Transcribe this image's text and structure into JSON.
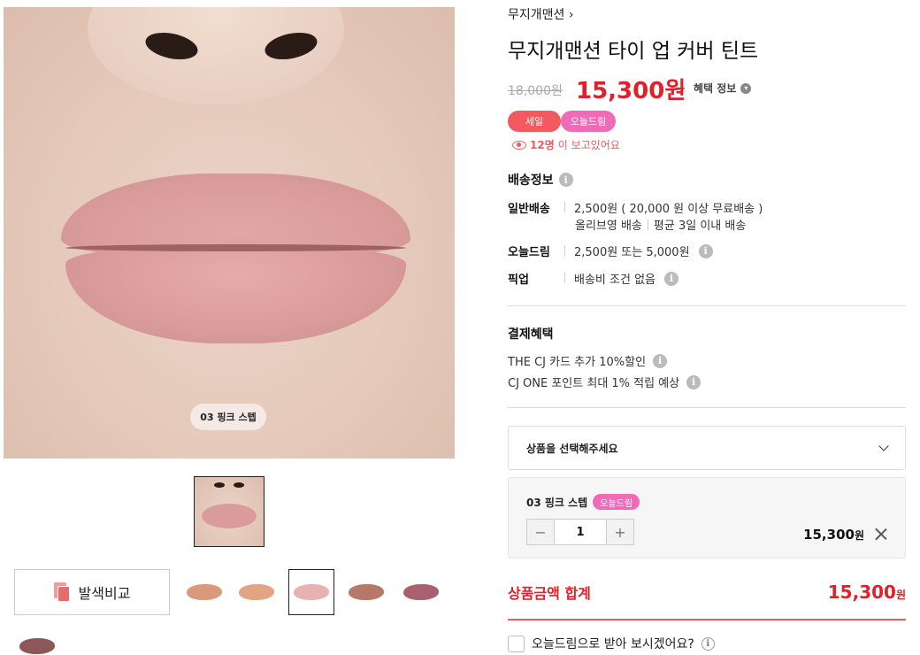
{
  "product": {
    "shade_overlay": "03 핑크 스텝",
    "brand": "무지개맨션",
    "brand_chevron": "›",
    "title": "무지개맨션 타이 업 커버 틴트",
    "original_price": "18,000원",
    "sale_price": "15,300원",
    "sale_tilde": "~",
    "benefit_label": "혜택 정보",
    "tags": [
      "세일",
      "오늘드림"
    ],
    "viewers_count": "12명",
    "viewers_text": "이 보고있어요"
  },
  "compare_button": {
    "label": "발색비교"
  },
  "swatches": [
    {
      "color": "#d99a7b",
      "selected": false
    },
    {
      "color": "#e2a482",
      "selected": false
    },
    {
      "color": "#e8b2b3",
      "selected": true
    },
    {
      "color": "#b47968",
      "selected": false
    },
    {
      "color": "#a9616d",
      "selected": false
    },
    {
      "color": "#8d5757",
      "selected": false
    }
  ],
  "shipping": {
    "title": "배송정보",
    "rows": [
      {
        "label": "일반배송",
        "value": "2,500원 ( 20,000 원 이상 무료배송 )"
      },
      {
        "label": "오늘드림",
        "value": "2,500원 또는 5,000원"
      },
      {
        "label": "픽업",
        "value": "배송비 조건 없음"
      }
    ],
    "sub_a": "올리브영 배송",
    "sub_b": "평균 3일 이내 배송"
  },
  "payment": {
    "title": "결제혜택",
    "rows": [
      "THE CJ 카드 추가 10%할인",
      "CJ ONE 포인트 최대 1% 적립 예상"
    ]
  },
  "option_select": {
    "placeholder": "상품을 선택해주세요"
  },
  "selected_option": {
    "name": "03 핑크 스텝",
    "tag": "오늘드림",
    "minus": "−",
    "qty": "1",
    "plus": "+",
    "price": "15,300",
    "unit": "원"
  },
  "total": {
    "label": "상품금액 합계",
    "value": "15,300",
    "unit": "원"
  },
  "today_delivery": {
    "label": "오늘드림으로 받아 보시겠어요?"
  },
  "colors": {
    "accent_red": "#e3202a",
    "sale_tag": "#f25a5f",
    "today_tag": "#f06ab8"
  }
}
